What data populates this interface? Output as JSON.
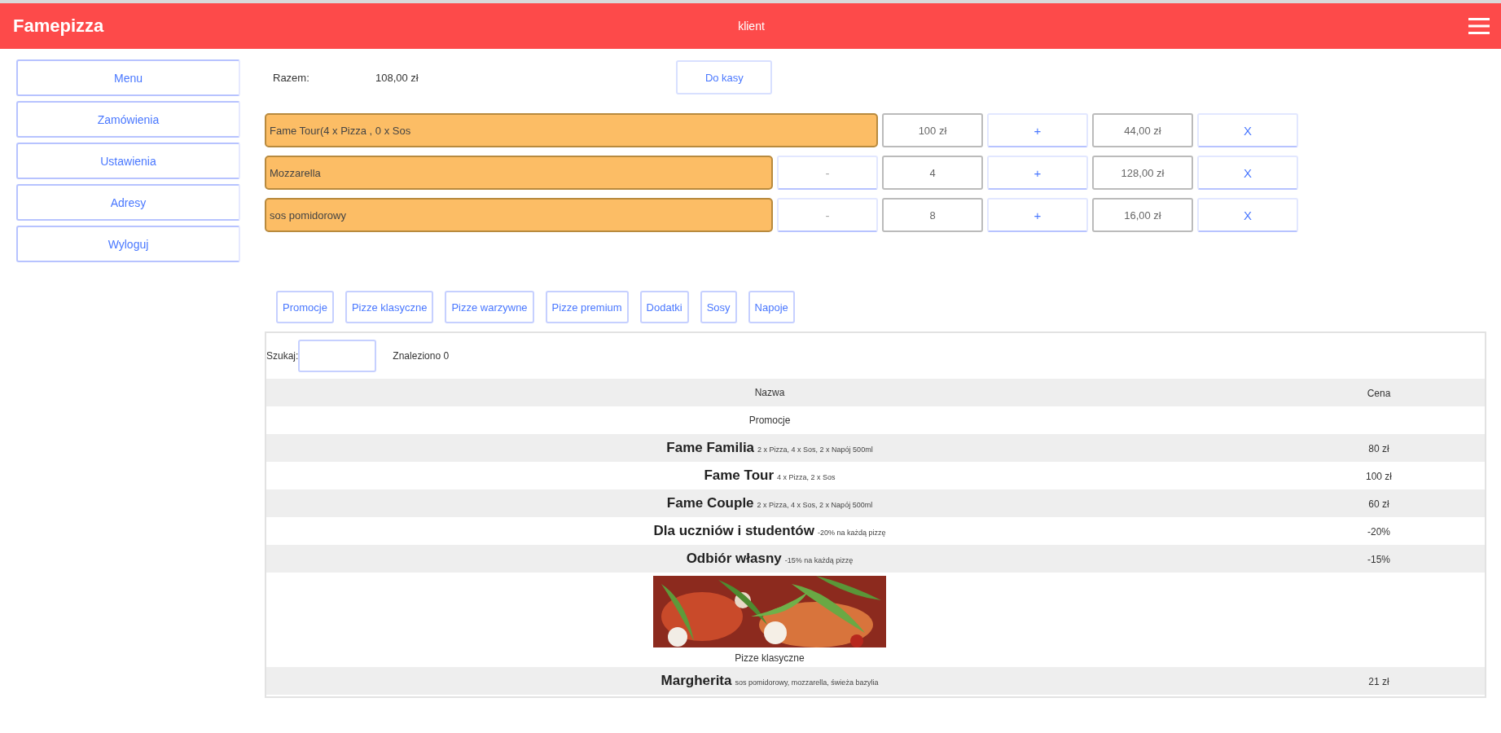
{
  "header": {
    "logo": "Famepizza",
    "user": "klient"
  },
  "sidebar": {
    "items": [
      {
        "label": "Menu"
      },
      {
        "label": "Zamówienia"
      },
      {
        "label": "Ustawienia"
      },
      {
        "label": "Adresy"
      },
      {
        "label": "Wyloguj"
      }
    ]
  },
  "summary": {
    "label": "Razem:",
    "total": "108,00 zł",
    "checkout": "Do kasy"
  },
  "cart": [
    {
      "name": "Fame Tour(4 x Pizza , 0 x Sos",
      "quantity": "100 zł",
      "plus": "+",
      "price": "44,00 zł",
      "remove": "X"
    },
    {
      "name": "Mozzarella",
      "minus": "-",
      "quantity": "4",
      "plus": "+",
      "price": "128,00 zł",
      "remove": "X"
    },
    {
      "name": "sos pomidorowy",
      "minus": "-",
      "quantity": "8",
      "plus": "+",
      "price": "16,00 zł",
      "remove": "X"
    }
  ],
  "categories": [
    "Promocje",
    "Pizze klasyczne",
    "Pizze warzywne",
    "Pizze premium",
    "Dodatki",
    "Sosy",
    "Napoje"
  ],
  "search": {
    "label": "Szukaj:",
    "found": "Znaleziono 0"
  },
  "table": {
    "columns": [
      "Nazwa",
      "Cena"
    ],
    "rows": [
      {
        "kind": "section",
        "title": "Promocje"
      },
      {
        "kind": "item",
        "name": "Fame Familia",
        "description": "2 x Pizza, 4 x Sos, 2 x Napój 500ml",
        "price": "80 zł"
      },
      {
        "kind": "item",
        "name": "Fame Tour",
        "description": "4 x Pizza, 2 x Sos",
        "price": "100 zł"
      },
      {
        "kind": "item",
        "name": "Fame Couple",
        "description": "2 x Pizza, 4 x Sos, 2 x Napój 500ml",
        "price": "60 zł"
      },
      {
        "kind": "item",
        "name": "Dla uczniów i studentów",
        "description": "-20% na każdą pizzę",
        "price": "-20%"
      },
      {
        "kind": "item",
        "name": "Odbiór własny",
        "description": "-15% na każdą pizzę",
        "price": "-15%"
      },
      {
        "kind": "picture",
        "title": "Pizze klasyczne"
      },
      {
        "kind": "item",
        "name": "Margherita",
        "description": "sos pomidorowy, mozzarella, świeża bazylia",
        "price": "21 zł"
      }
    ]
  }
}
